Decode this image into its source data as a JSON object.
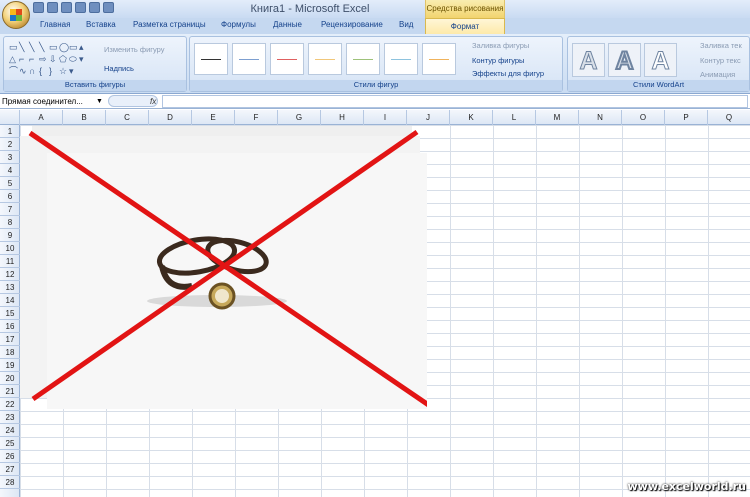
{
  "window": {
    "title": "Книга1 - Microsoft Excel",
    "context_title": "Средства рисования"
  },
  "tabs": [
    "Главная",
    "Вставка",
    "Разметка страницы",
    "Формулы",
    "Данные",
    "Рецензирование",
    "Вид"
  ],
  "active_tab": "Формат",
  "ribbon": {
    "insert_shapes": {
      "label": "Вставить фигуры",
      "edit_shape": "Изменить фигуру",
      "text_box": "Надпись"
    },
    "shape_styles": {
      "label": "Стили фигур",
      "fill": "Заливка фигуры",
      "outline": "Контур фигуры",
      "effects": "Эффекты для фигур",
      "style_colors": [
        "#333333",
        "#7d9fd0",
        "#e06060",
        "#f1c77a",
        "#9ec27a",
        "#8ec3de",
        "#f0b35c"
      ]
    },
    "wordart": {
      "label": "Стили WordArt",
      "text_fill": "Заливка тек",
      "text_outline": "Контур текс",
      "animation": "Анимация"
    }
  },
  "formula_bar": {
    "name_box": "Прямая соединител...",
    "fx": "fx",
    "formula": ""
  },
  "columns": [
    "A",
    "B",
    "C",
    "D",
    "E",
    "F",
    "G",
    "H",
    "I",
    "J",
    "K",
    "L",
    "M",
    "N",
    "O",
    "P",
    "Q"
  ],
  "rows": [
    "1",
    "2",
    "3",
    "4",
    "5",
    "6",
    "7",
    "8",
    "9",
    "10",
    "11",
    "12",
    "13",
    "14",
    "15",
    "16",
    "17",
    "18",
    "19",
    "20",
    "21",
    "22",
    "23",
    "24",
    "25",
    "26",
    "27",
    "28"
  ],
  "watermark": "www.excelworld.ru",
  "colors": {
    "cross_line": "#e21414",
    "ribbon_bg": "#dbe7f6",
    "context_tab": "#f6dd86"
  }
}
